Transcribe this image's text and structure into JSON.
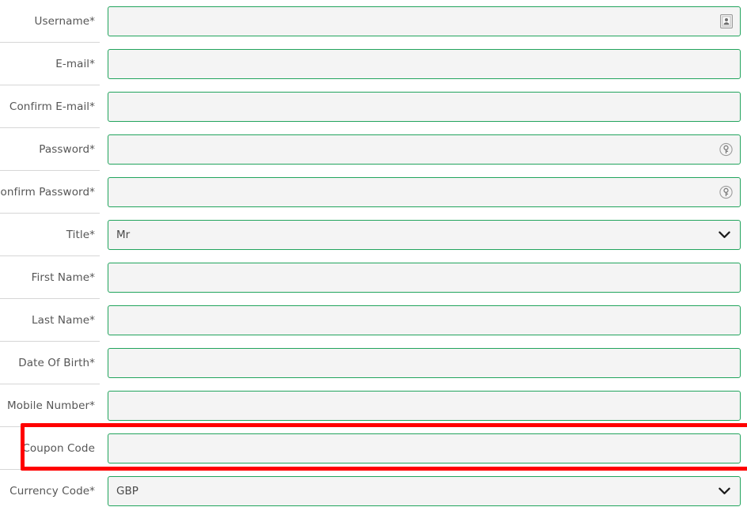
{
  "form": {
    "rows": [
      {
        "label": "Username*",
        "type": "text",
        "value": "",
        "placeholder": "",
        "icon": "contact-card-icon",
        "name": "username"
      },
      {
        "label": "E-mail*",
        "type": "text",
        "value": "",
        "placeholder": "",
        "icon": "",
        "name": "email"
      },
      {
        "label": "Confirm E-mail*",
        "type": "text",
        "value": "",
        "placeholder": "",
        "icon": "",
        "name": "confirm-email"
      },
      {
        "label": "Password*",
        "type": "password",
        "value": "",
        "placeholder": "",
        "icon": "key-icon",
        "name": "password"
      },
      {
        "label": "Confirm Password*",
        "type": "password",
        "value": "",
        "placeholder": "",
        "icon": "key-icon",
        "name": "confirm-password"
      },
      {
        "label": "Title*",
        "type": "select",
        "value": "Mr",
        "placeholder": "",
        "icon": "chevron-down-icon",
        "name": "title"
      },
      {
        "label": "First Name*",
        "type": "text",
        "value": "",
        "placeholder": "",
        "icon": "",
        "name": "first-name"
      },
      {
        "label": "Last Name*",
        "type": "text",
        "value": "",
        "placeholder": "",
        "icon": "",
        "name": "last-name"
      },
      {
        "label": "Date Of Birth*",
        "type": "text",
        "value": "",
        "placeholder": "",
        "icon": "",
        "name": "date-of-birth"
      },
      {
        "label": "Mobile Number*",
        "type": "text",
        "value": "",
        "placeholder": "",
        "icon": "",
        "name": "mobile-number"
      },
      {
        "label": "Coupon Code",
        "type": "text",
        "value": "",
        "placeholder": "",
        "icon": "",
        "name": "coupon-code"
      },
      {
        "label": "Currency Code*",
        "type": "select",
        "value": "GBP",
        "placeholder": "",
        "icon": "chevron-down-icon",
        "name": "currency-code"
      }
    ]
  },
  "annotation": {
    "target_row": "coupon-code",
    "color": "#ff0000"
  },
  "colors": {
    "field_border": "#22a45d",
    "field_background": "#f4f4f4",
    "label_text": "#565656",
    "row_divider": "#d6d6d6",
    "highlight": "#ff0000"
  }
}
